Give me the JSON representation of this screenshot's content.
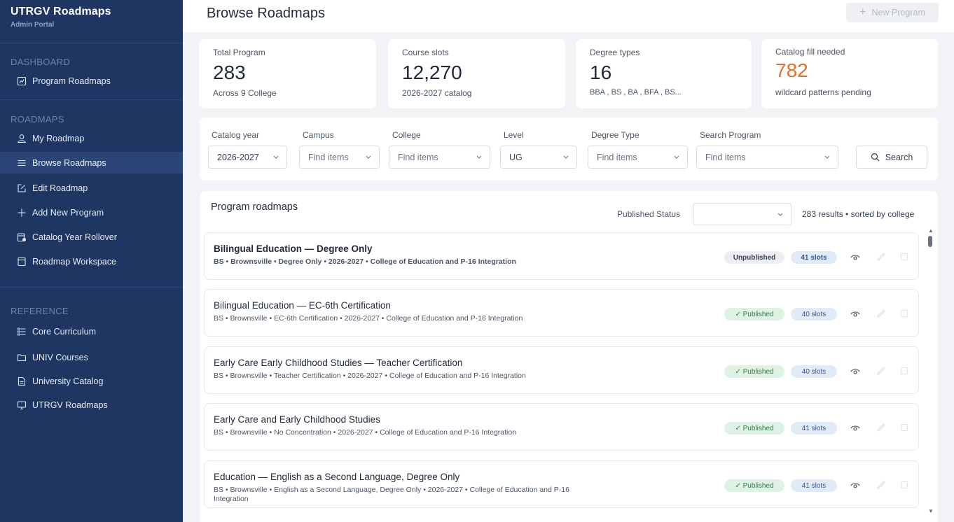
{
  "sidebar": {
    "brand_title": "UTRGV Roadmaps",
    "brand_sub": "Admin Portal",
    "sections": [
      {
        "label": "DASHBOARD",
        "items": [
          {
            "label": "Program Roadmaps",
            "icon": "chart-box-icon"
          }
        ]
      },
      {
        "label": "ROADMAPS",
        "items": [
          {
            "label": "My Roadmap",
            "icon": "user-icon"
          },
          {
            "label": "Browse Roadmaps",
            "icon": "menu-icon",
            "active": true
          },
          {
            "label": "Edit Roadmap",
            "icon": "edit-icon"
          },
          {
            "label": "Add New Program",
            "icon": "plus-icon"
          },
          {
            "label": "Catalog Year Rollover",
            "icon": "calendar-icon"
          },
          {
            "label": "Roadmap Workspace",
            "icon": "workspace-icon"
          }
        ]
      },
      {
        "label": "REFERENCE",
        "items": [
          {
            "label": "Core Curriculum",
            "icon": "list-icon"
          },
          {
            "label": "UNIV Courses",
            "icon": "folder-icon"
          },
          {
            "label": "University Catalog",
            "icon": "document-icon"
          },
          {
            "label": "UTRGV Roadmaps",
            "icon": "monitor-icon"
          }
        ]
      }
    ]
  },
  "header": {
    "title": "Browse Roadmaps",
    "new_program_label": "New Program",
    "new_program_icon": "plus-icon"
  },
  "stats": [
    {
      "label": "Total Program",
      "value": "283",
      "sub": "Across 9 College"
    },
    {
      "label": "Course slots",
      "value": "12,270",
      "sub": "2026-2027 catalog"
    },
    {
      "label": "Degree types",
      "value": "16",
      "sub": "BBA , BS  , BA  , BFA , BS..."
    },
    {
      "label": "Catalog fill needed",
      "value": "782",
      "sub": "wildcard patterns pending",
      "accent": "#e0702c"
    }
  ],
  "filters": {
    "catalog_year": {
      "label": "Catalog year",
      "value": "2026-2027"
    },
    "campus": {
      "label": "Campus",
      "placeholder": "Find items"
    },
    "college": {
      "label": "College",
      "placeholder": "Find items"
    },
    "level": {
      "label": "Level",
      "value": "UG"
    },
    "degree_type": {
      "label": "Degree Type",
      "placeholder": "Find items"
    },
    "search_program": {
      "label": "Search Program",
      "placeholder": "Find items"
    },
    "search_button": "Search"
  },
  "results": {
    "title": "Program roadmaps",
    "published_status_label": "Published Status",
    "published_status_value": "",
    "count_text": "283 results • sorted by college",
    "rows": [
      {
        "title": "Bilingual Education — Degree Only",
        "meta": "BS   • Brownsville • Degree Only • 2026-2027 • College of Education and P-16 Integration",
        "status": "Unpublished",
        "slots": "41 slots"
      },
      {
        "title": "Bilingual Education — EC-6th Certification",
        "meta": "BS   • Brownsville • EC-6th Certification • 2026-2027 • College of Education and P-16 Integration",
        "status": "✓ Published",
        "slots": "40 slots"
      },
      {
        "title": "Early Care Early Childhood Studies — Teacher Certification",
        "meta": "BS   • Brownsville • Teacher Certification • 2026-2027 • College of Education and P-16 Integration",
        "status": "✓ Published",
        "slots": "40 slots"
      },
      {
        "title": "Early Care and Early Childhood Studies",
        "meta": "BS   • Brownsville • No Concentration • 2026-2027 • College of Education and P-16 Integration",
        "status": "✓ Published",
        "slots": "41 slots"
      },
      {
        "title": "Education — English as a Second Language, Degree Only",
        "meta": "BS   • Brownsville • English as a Second Language, Degree Only • 2026-2027 • College of Education and P-16 Integration",
        "status": "✓ Published",
        "slots": "41 slots"
      }
    ]
  },
  "colors": {
    "sidebar_bg": "#1f3562",
    "accent_orange": "#e0702c",
    "published_bg": "#dff3e4",
    "slots_bg": "#e1ebf7"
  }
}
